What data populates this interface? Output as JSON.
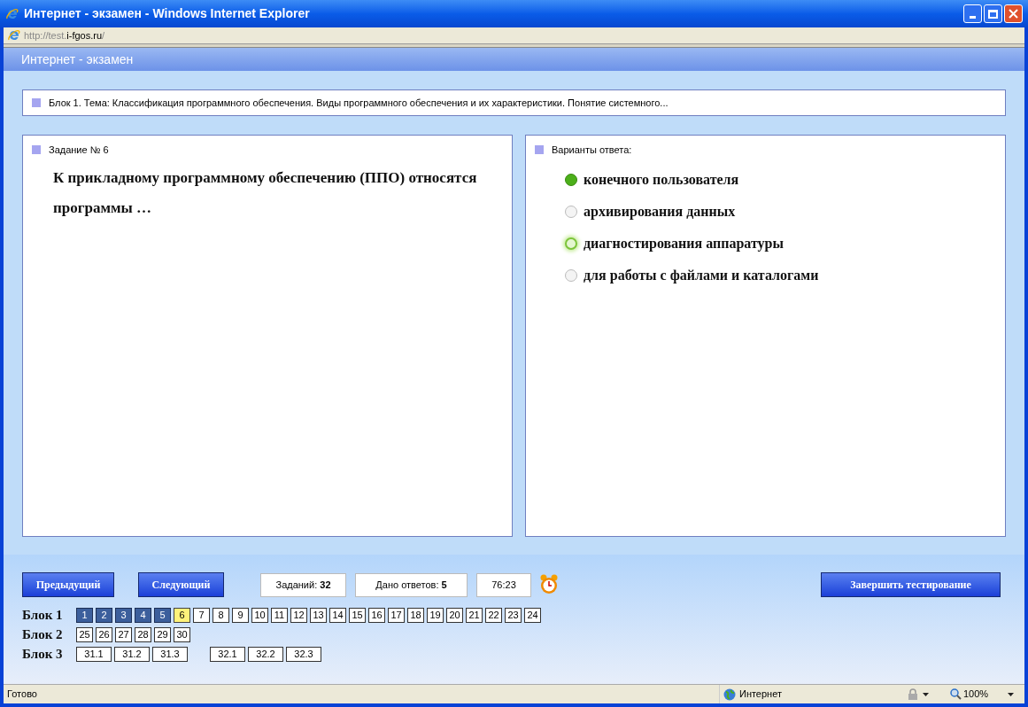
{
  "window": {
    "title": "Интернет - экзамен - Windows Internet Explorer"
  },
  "address": {
    "prefix": "http://test.",
    "domain": "i-fgos.ru",
    "suffix": "/"
  },
  "page_header": "Интернет - экзамен",
  "topic": "Блок 1. Тема: Классификация программного обеспечения. Виды программного обеспечения и их характеристики. Понятие системного...",
  "task": {
    "heading": "Задание № 6",
    "text": "К прикладному программному обеспечению (ППО) относятся программы …"
  },
  "answers": {
    "heading": "Варианты ответа:",
    "options": [
      {
        "label": "конечного пользователя",
        "selected": true,
        "highlighted": false
      },
      {
        "label": "архивирования данных",
        "selected": false,
        "highlighted": false
      },
      {
        "label": "диагностирования аппаратуры",
        "selected": false,
        "highlighted": true
      },
      {
        "label": "для работы с файлами и каталогами",
        "selected": false,
        "highlighted": false
      }
    ]
  },
  "buttons": {
    "prev": "Предыдущий",
    "next": "Следующий",
    "finish": "Завершить тестирование"
  },
  "counters": {
    "tasks_label": "Заданий:",
    "tasks_value": "32",
    "answered_label": "Дано ответов:",
    "answered_value": "5",
    "timer": "76:23"
  },
  "blocks": [
    {
      "label": "Блок 1",
      "groups": [
        [
          {
            "label": "1",
            "kind": "answered"
          },
          {
            "label": "2",
            "kind": "answered"
          },
          {
            "label": "3",
            "kind": "answered"
          },
          {
            "label": "4",
            "kind": "answered"
          },
          {
            "label": "5",
            "kind": "answered"
          },
          {
            "label": "6",
            "kind": "current"
          },
          {
            "label": "7",
            "kind": "open"
          },
          {
            "label": "8",
            "kind": "open"
          },
          {
            "label": "9",
            "kind": "open"
          },
          {
            "label": "10",
            "kind": "open"
          },
          {
            "label": "11",
            "kind": "open"
          },
          {
            "label": "12",
            "kind": "open"
          },
          {
            "label": "13",
            "kind": "open"
          },
          {
            "label": "14",
            "kind": "open"
          },
          {
            "label": "15",
            "kind": "open"
          },
          {
            "label": "16",
            "kind": "open"
          },
          {
            "label": "17",
            "kind": "open"
          },
          {
            "label": "18",
            "kind": "open"
          },
          {
            "label": "19",
            "kind": "open"
          },
          {
            "label": "20",
            "kind": "open"
          },
          {
            "label": "21",
            "kind": "open"
          },
          {
            "label": "22",
            "kind": "open"
          },
          {
            "label": "23",
            "kind": "open"
          },
          {
            "label": "24",
            "kind": "open"
          }
        ]
      ]
    },
    {
      "label": "Блок 2",
      "groups": [
        [
          {
            "label": "25",
            "kind": "open"
          },
          {
            "label": "26",
            "kind": "open"
          },
          {
            "label": "27",
            "kind": "open"
          },
          {
            "label": "28",
            "kind": "open"
          },
          {
            "label": "29",
            "kind": "open"
          },
          {
            "label": "30",
            "kind": "open"
          }
        ]
      ]
    },
    {
      "label": "Блок 3",
      "groups": [
        [
          {
            "label": "31.1",
            "kind": "open"
          },
          {
            "label": "31.2",
            "kind": "open"
          },
          {
            "label": "31.3",
            "kind": "open"
          }
        ],
        [
          {
            "label": "32.1",
            "kind": "open"
          },
          {
            "label": "32.2",
            "kind": "open"
          },
          {
            "label": "32.3",
            "kind": "open"
          }
        ]
      ]
    }
  ],
  "status_bar": {
    "status": "Готово",
    "zone": "Интернет",
    "zoom": "100%"
  }
}
